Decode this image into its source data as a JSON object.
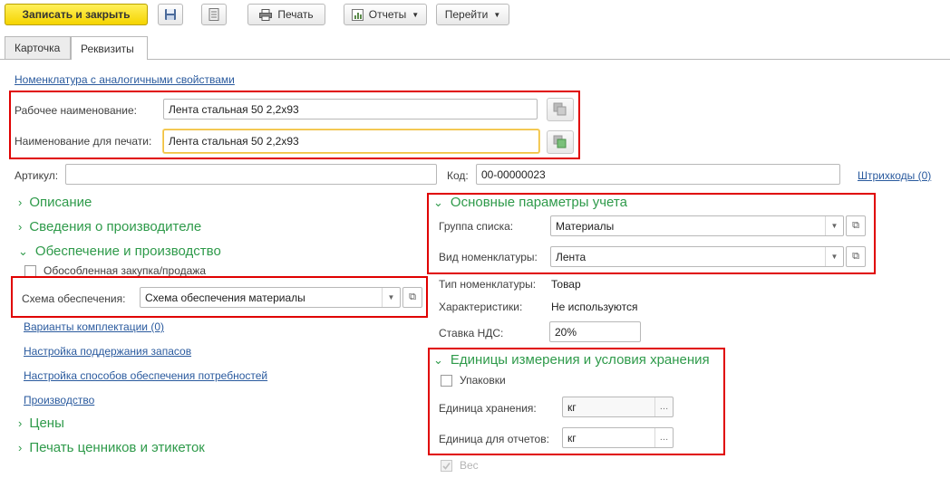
{
  "toolbar": {
    "save_close": "Записать и закрыть",
    "print": "Печать",
    "reports": "Отчеты",
    "goto": "Перейти"
  },
  "tabs": [
    {
      "label": "Карточка"
    },
    {
      "label": "Реквизиты"
    }
  ],
  "links": {
    "analog": "Номенклатура с аналогичными свойствами",
    "barcodes": "Штрихкоды (0)",
    "variants": "Варианты комплектации (0)",
    "stock_support": "Настройка поддержания запасов",
    "supply_methods": "Настройка способов обеспечения потребностей",
    "production": "Производство"
  },
  "names": {
    "work_label": "Рабочее наименование:",
    "work_value": "Лента стальная 50 2,2x93",
    "print_label": "Наименование для печати:",
    "print_value": "Лента стальная 50 2,2x93"
  },
  "article": {
    "label": "Артикул:",
    "value": ""
  },
  "code": {
    "label": "Код:",
    "value": "00-00000023"
  },
  "sections": {
    "description": "Описание",
    "manufacturer": "Сведения о производителе",
    "supply": "Обеспечение и производство",
    "prices": "Цены",
    "labels": "Печать ценников и этикеток",
    "main_params": "Основные параметры учета",
    "units": "Единицы измерения и условия хранения"
  },
  "supply": {
    "separate_purchase": "Обособленная закупка/продажа",
    "scheme_label": "Схема обеспечения:",
    "scheme_value": "Схема обеспечения материалы"
  },
  "params": {
    "group_label": "Группа списка:",
    "group_value": "Материалы",
    "kind_label": "Вид номенклатуры:",
    "kind_value": "Лента",
    "type_label": "Тип номенклатуры:",
    "type_value": "Товар",
    "chars_label": "Характеристики:",
    "chars_value": "Не используются",
    "vat_label": "Ставка НДС:",
    "vat_value": "20%"
  },
  "units": {
    "packs": "Упаковки",
    "storage_label": "Единица хранения:",
    "storage_value": "кг",
    "report_label": "Единица для отчетов:",
    "report_value": "кг",
    "weight": "Вес"
  },
  "colors": {
    "accent_green": "#2e9a4a",
    "highlight_red": "#e00000",
    "link_blue": "#2a5a9e",
    "primary_yellow": "#f5d400"
  }
}
